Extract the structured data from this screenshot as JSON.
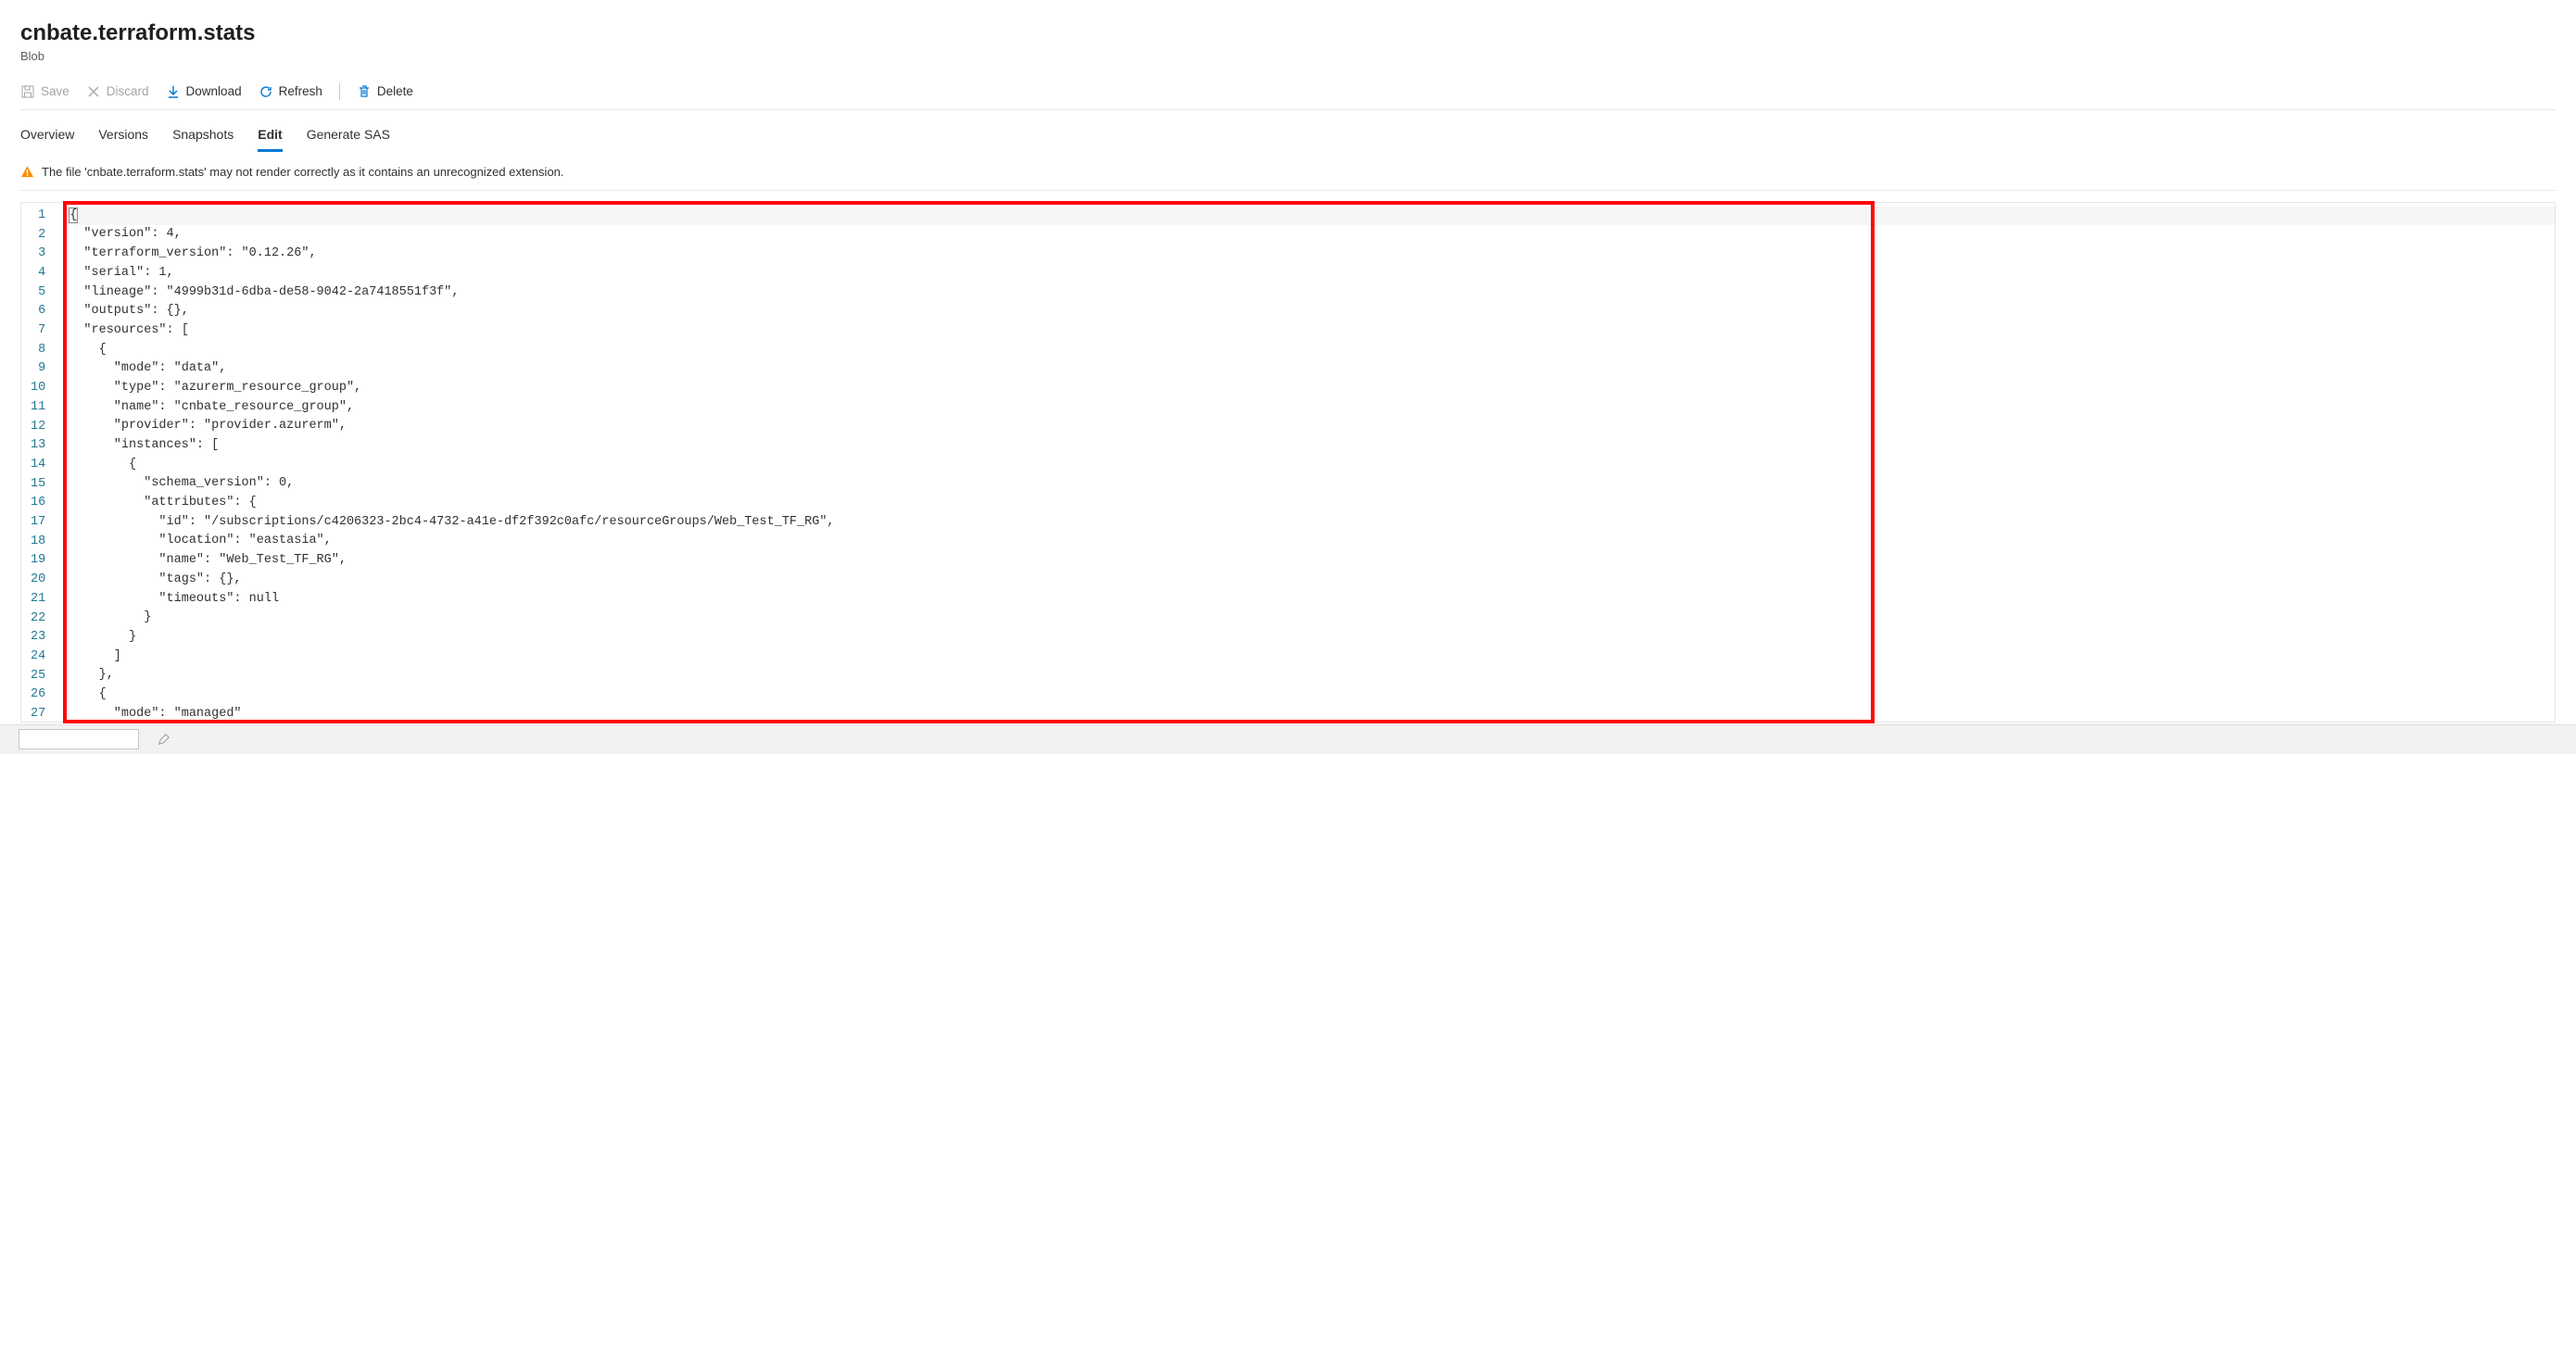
{
  "header": {
    "title": "cnbate.terraform.stats",
    "subtitle": "Blob"
  },
  "toolbar": {
    "save_label": "Save",
    "discard_label": "Discard",
    "download_label": "Download",
    "refresh_label": "Refresh",
    "delete_label": "Delete"
  },
  "tabs": {
    "overview": "Overview",
    "versions": "Versions",
    "snapshots": "Snapshots",
    "edit": "Edit",
    "generate_sas": "Generate SAS"
  },
  "warning_text": "The file 'cnbate.terraform.stats' may not render correctly as it contains an unrecognized extension.",
  "editor": {
    "lines": [
      "{",
      "  \"version\": 4,",
      "  \"terraform_version\": \"0.12.26\",",
      "  \"serial\": 1,",
      "  \"lineage\": \"4999b31d-6dba-de58-9042-2a7418551f3f\",",
      "  \"outputs\": {},",
      "  \"resources\": [",
      "    {",
      "      \"mode\": \"data\",",
      "      \"type\": \"azurerm_resource_group\",",
      "      \"name\": \"cnbate_resource_group\",",
      "      \"provider\": \"provider.azurerm\",",
      "      \"instances\": [",
      "        {",
      "          \"schema_version\": 0,",
      "          \"attributes\": {",
      "            \"id\": \"/subscriptions/c4206323-2bc4-4732-a41e-df2f392c0afc/resourceGroups/Web_Test_TF_RG\",",
      "            \"location\": \"eastasia\",",
      "            \"name\": \"Web_Test_TF_RG\",",
      "            \"tags\": {},",
      "            \"timeouts\": null",
      "          }",
      "        }",
      "      ]",
      "    },",
      "    {",
      "      \"mode\": \"managed\""
    ]
  },
  "colors": {
    "accent": "#0078d4",
    "annotation_border": "#ff0404"
  }
}
